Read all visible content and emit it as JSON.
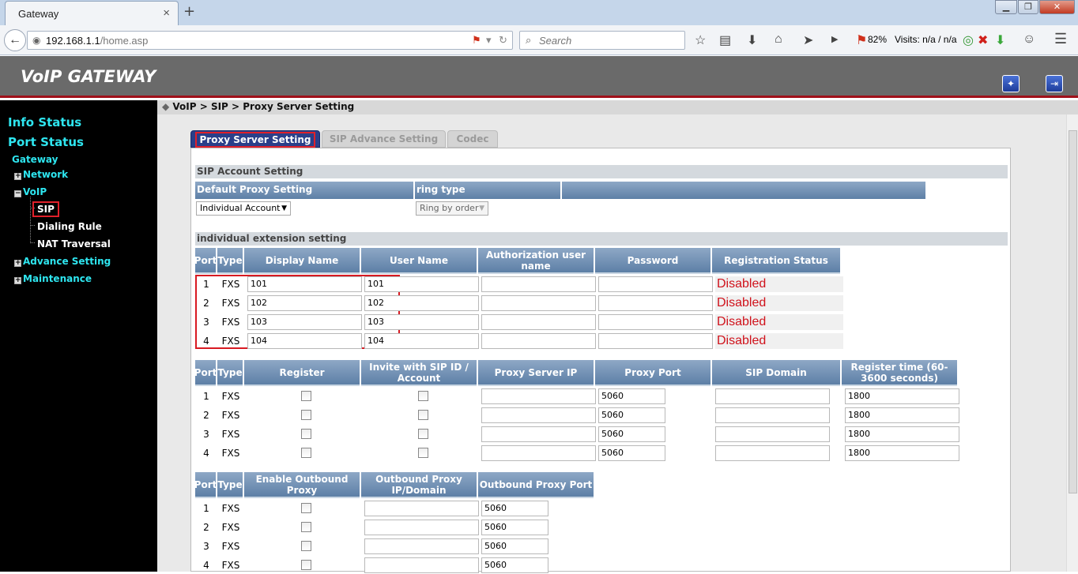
{
  "browser": {
    "tab_title": "Gateway",
    "tab_close": "×",
    "new_tab": "+",
    "window_buttons": [
      "▁",
      "❐",
      "✕"
    ],
    "url_host": "192.168.1.1",
    "url_path": "/home.asp",
    "search_placeholder": "Search",
    "zoom_percent": "82%",
    "visits": "Visits: n/a / n/a"
  },
  "header": {
    "title": "VoIP GATEWAY"
  },
  "sidebar": {
    "info_status": "Info Status",
    "port_status": "Port Status",
    "gateway": "Gateway",
    "network": "Network",
    "voip": "VoIP",
    "sip": "SIP",
    "dialing_rule": "Dialing Rule",
    "nat_traversal": "NAT Traversal",
    "advance_setting": "Advance Setting",
    "maintenance": "Maintenance"
  },
  "breadcrumb": "VoIP > SIP > Proxy Server Setting",
  "tabs": [
    "Proxy Server Setting",
    "SIP Advance Setting",
    "Codec"
  ],
  "sip_account": {
    "section_title": "SIP Account Setting",
    "col_default_proxy": "Default Proxy Setting",
    "col_ring_type": "ring type",
    "default_proxy_value": "Individual Account",
    "ring_type_value": "Ring by order"
  },
  "extension": {
    "section_title": "individual extension setting",
    "headers": [
      "Port",
      "Type",
      "Display Name",
      "User Name",
      "Authorization user name",
      "Password",
      "Registration Status"
    ],
    "rows": [
      {
        "port": "1",
        "type": "FXS",
        "display": "101",
        "user": "101",
        "auth": "",
        "password": "",
        "status": "Disabled"
      },
      {
        "port": "2",
        "type": "FXS",
        "display": "102",
        "user": "102",
        "auth": "",
        "password": "",
        "status": "Disabled"
      },
      {
        "port": "3",
        "type": "FXS",
        "display": "103",
        "user": "103",
        "auth": "",
        "password": "",
        "status": "Disabled"
      },
      {
        "port": "4",
        "type": "FXS",
        "display": "104",
        "user": "104",
        "auth": "",
        "password": "",
        "status": "Disabled"
      }
    ]
  },
  "register": {
    "headers": [
      "Port",
      "Type",
      "Register",
      "Invite with SIP ID / Account",
      "Proxy Server IP",
      "Proxy Port",
      "SIP Domain",
      "Register time (60-3600 seconds)"
    ],
    "rows": [
      {
        "port": "1",
        "type": "FXS",
        "proxy_ip": "",
        "proxy_port": "5060",
        "domain": "",
        "reg_time": "1800"
      },
      {
        "port": "2",
        "type": "FXS",
        "proxy_ip": "",
        "proxy_port": "5060",
        "domain": "",
        "reg_time": "1800"
      },
      {
        "port": "3",
        "type": "FXS",
        "proxy_ip": "",
        "proxy_port": "5060",
        "domain": "",
        "reg_time": "1800"
      },
      {
        "port": "4",
        "type": "FXS",
        "proxy_ip": "",
        "proxy_port": "5060",
        "domain": "",
        "reg_time": "1800"
      }
    ]
  },
  "outbound": {
    "headers": [
      "Port",
      "Type",
      "Enable Outbound Proxy",
      "Outbound Proxy IP/Domain",
      "Outbound Proxy Port"
    ],
    "rows": [
      {
        "port": "1",
        "type": "FXS",
        "ip": "",
        "ob_port": "5060"
      },
      {
        "port": "2",
        "type": "FXS",
        "ip": "",
        "ob_port": "5060"
      },
      {
        "port": "3",
        "type": "FXS",
        "ip": "",
        "ob_port": "5060"
      },
      {
        "port": "4",
        "type": "FXS",
        "ip": "",
        "ob_port": "5060"
      }
    ]
  }
}
